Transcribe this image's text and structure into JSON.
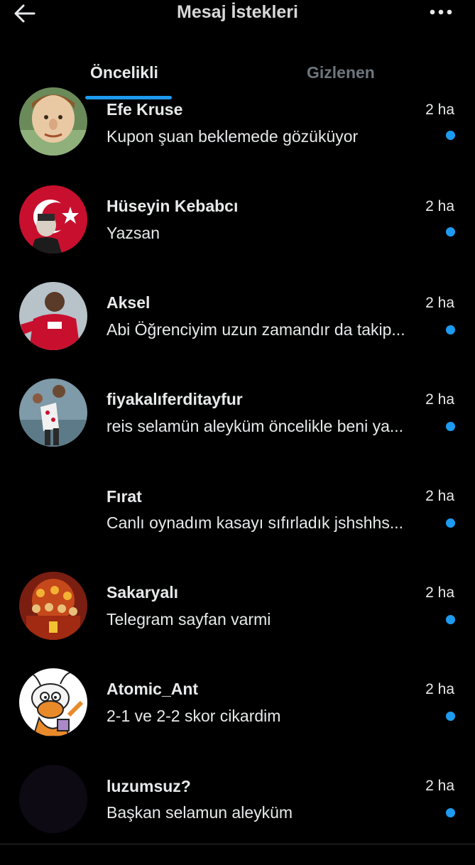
{
  "header": {
    "title": "Mesaj İstekleri",
    "back_icon": "arrow-left-icon",
    "more_icon": "more-horizontal-icon"
  },
  "tabs": [
    {
      "label": "Öncelikli",
      "active": true
    },
    {
      "label": "Gizlenen",
      "active": false
    }
  ],
  "colors": {
    "accent": "#1d9bf0",
    "background": "#000000",
    "muted": "#6e767d"
  },
  "conversations": [
    {
      "name": "Efe Kruse",
      "message": "Kupon şuan beklemede gözüküyor",
      "time": "2 ha",
      "unread": true
    },
    {
      "name": "Hüseyin Kebabcı",
      "message": "Yazsan",
      "time": "2 ha",
      "unread": true
    },
    {
      "name": "Aksel",
      "message": "Abi Öğrenciyim uzun zamandır da takip...",
      "time": "2 ha",
      "unread": true
    },
    {
      "name": "fiyakalıferditayfur",
      "message": "reis selamün aleyküm öncelikle beni ya...",
      "time": "2 ha",
      "unread": true
    },
    {
      "name": "Fırat",
      "message": "Canlı oynadım kasayı sıfırladık jshshhs...",
      "time": "2 ha",
      "unread": true
    },
    {
      "name": "Sakaryalı",
      "message": "Telegram sayfan varmi",
      "time": "2 ha",
      "unread": true
    },
    {
      "name": "Atomic_Ant",
      "message": "2-1 ve 2-2 skor cikardim",
      "time": "2 ha",
      "unread": true
    },
    {
      "name": "luzumsuz?",
      "message": "Başkan selamun aleyküm",
      "time": "2 ha",
      "unread": true
    }
  ]
}
